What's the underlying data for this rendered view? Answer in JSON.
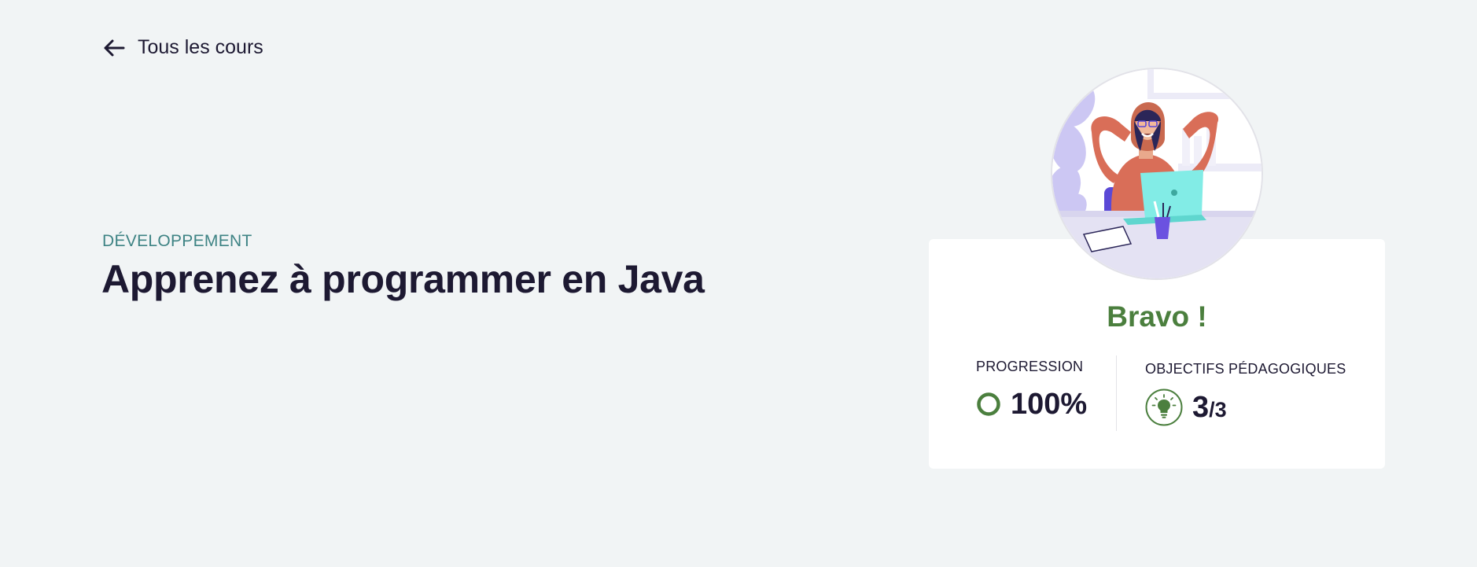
{
  "nav": {
    "back_label": "Tous les cours"
  },
  "course": {
    "category": "DÉVELOPPEMENT",
    "title": "Apprenez à programmer en Java"
  },
  "completion_card": {
    "headline": "Bravo !",
    "progress": {
      "label": "PROGRESSION",
      "value": "100%",
      "fraction": 1.0
    },
    "objectives": {
      "label": "OBJECTIFS PÉDAGOGIQUES",
      "done": "3",
      "total": "/3"
    }
  },
  "colors": {
    "background": "#f1f4f5",
    "text": "#1d1932",
    "category": "#3e8384",
    "success": "#4b7f3e"
  },
  "icons": {
    "back": "arrow-left-icon",
    "progress": "progress-ring-icon",
    "objectives": "lightbulb-icon"
  }
}
